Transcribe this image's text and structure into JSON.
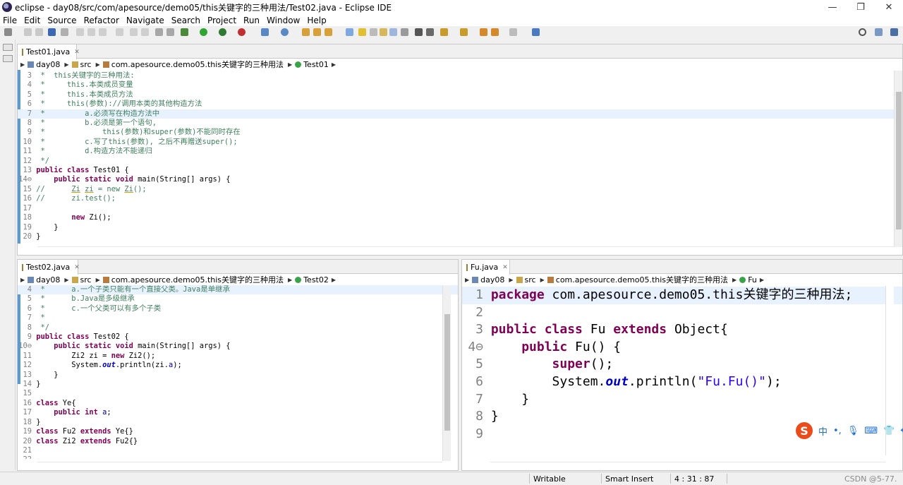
{
  "window": {
    "title": "eclipse - day08/src/com/apesource/demo05/this关键字的三种用法/Test02.java - Eclipse IDE",
    "minimize": "—",
    "restore": "❐",
    "close": "✕"
  },
  "menu": [
    "File",
    "Edit",
    "Source",
    "Refactor",
    "Navigate",
    "Search",
    "Project",
    "Run",
    "Window",
    "Help"
  ],
  "top_editor": {
    "tab_label": "Test01.java",
    "tab_close": "✕",
    "breadcrumb": [
      "day08",
      "src",
      "com.apesource.demo05.this关键字的三种用法",
      "Test01"
    ],
    "lines": [
      {
        "n": "3",
        "text": " *  this关键字的三种用法:"
      },
      {
        "n": "4",
        "text": " *     this.本类成员变量"
      },
      {
        "n": "5",
        "text": " *     this.本类成员方法"
      },
      {
        "n": "6",
        "text": " *     this(参数)://调用本类的其他构造方法"
      },
      {
        "n": "7",
        "text": " *         a.必须写在构造方法中"
      },
      {
        "n": "8",
        "text": " *         b.必须是第一个语句,"
      },
      {
        "n": "9",
        "text": " *             this(参数)和super(参数)不能同时存在"
      },
      {
        "n": "10",
        "text": " *         c.写了this(参数), 之后不再赠送super();"
      },
      {
        "n": "11",
        "text": " *         d.构造方法不能递归"
      },
      {
        "n": "12",
        "text": " */"
      },
      {
        "n": "13",
        "text": "public class Test01 {"
      },
      {
        "n": "14⊖",
        "text": "    public static void main(String[] args) {"
      },
      {
        "n": "15",
        "text": "//      Zi zi = new Zi();"
      },
      {
        "n": "16",
        "text": "//      zi.test();"
      },
      {
        "n": "17",
        "text": ""
      },
      {
        "n": "18",
        "text": "        new Zi();"
      },
      {
        "n": "19",
        "text": "    }"
      },
      {
        "n": "20",
        "text": "}"
      }
    ]
  },
  "bottom_left_editor": {
    "tab_label": "Test02.java",
    "tab_close": "✕",
    "breadcrumb": [
      "day08",
      "src",
      "com.apesource.demo05.this关键字的三种用法",
      "Test02"
    ],
    "lines": [
      {
        "n": "4",
        "text": " *      a.一个子类只能有一个直接父类。Java是单继承"
      },
      {
        "n": "5",
        "text": " *      b.Java是多级继承"
      },
      {
        "n": "6",
        "text": " *      c.一个父类可以有多个子类"
      },
      {
        "n": "7",
        "text": " *"
      },
      {
        "n": "8",
        "text": " */"
      },
      {
        "n": "9",
        "text": "public class Test02 {"
      },
      {
        "n": "10⊖",
        "text": "    public static void main(String[] args) {"
      },
      {
        "n": "11",
        "text": "        Zi2 zi = new Zi2();"
      },
      {
        "n": "12",
        "text": "        System.out.println(zi.a);"
      },
      {
        "n": "13",
        "text": "    }"
      },
      {
        "n": "14",
        "text": "}"
      },
      {
        "n": "15",
        "text": ""
      },
      {
        "n": "16",
        "text": "class Ye{"
      },
      {
        "n": "17",
        "text": "    public int a;"
      },
      {
        "n": "18",
        "text": "}"
      },
      {
        "n": "19",
        "text": "class Fu2 extends Ye{}"
      },
      {
        "n": "20",
        "text": "class Zi2 extends Fu2{}"
      },
      {
        "n": "21",
        "text": ""
      },
      {
        "n": "22",
        "text": ""
      }
    ]
  },
  "bottom_right_editor": {
    "tab_label": "Fu.java",
    "tab_close": "✕",
    "breadcrumb": [
      "day08",
      "src",
      "com.apesource.demo05.this关键字的三种用法",
      "Fu"
    ],
    "lines": [
      {
        "n": "1",
        "text": "package com.apesource.demo05.this关键字的三种用法;"
      },
      {
        "n": "2",
        "text": ""
      },
      {
        "n": "3",
        "text": "public class Fu extends Object{"
      },
      {
        "n": "4⊖",
        "text": "    public Fu() {"
      },
      {
        "n": "5",
        "text": "        super();"
      },
      {
        "n": "6",
        "text": "        System.out.println(\"Fu.Fu()\");"
      },
      {
        "n": "7",
        "text": "    }"
      },
      {
        "n": "8",
        "text": "}"
      },
      {
        "n": "9",
        "text": ""
      }
    ]
  },
  "status": {
    "writable": "Writable",
    "insert_mode": "Smart Insert",
    "position": "4 : 31 : 87",
    "watermark": "CSDN @5-77."
  },
  "ime": {
    "logo": "S",
    "lang": "中",
    "punct": "•,",
    "mic": "🎙",
    "keyboard": "⌨",
    "skin": "👕",
    "apps": "✥"
  }
}
